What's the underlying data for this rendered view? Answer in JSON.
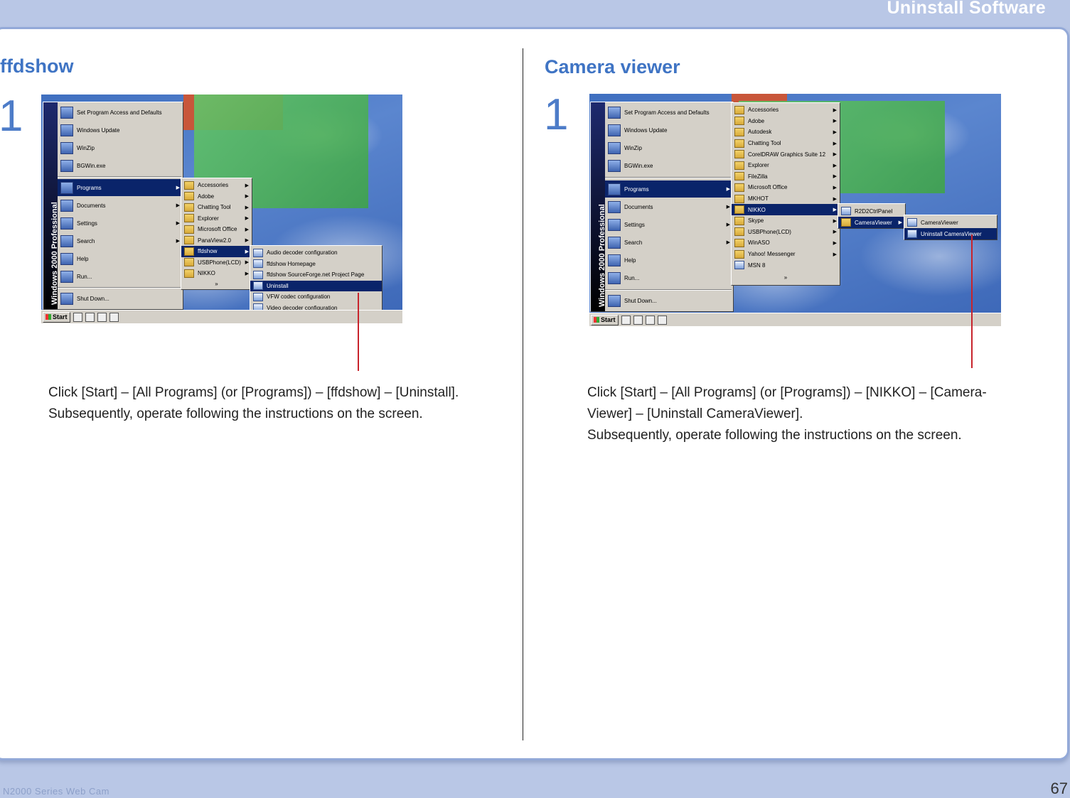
{
  "header": {
    "title": "Uninstall Software"
  },
  "left": {
    "title": "ffdshow",
    "step": "1",
    "instructions": [
      "Click [Start] – [All Programs] (or [Programs]) – [ffdshow] – [Uninstall].",
      "Subsequently, operate following the instructions on the screen."
    ],
    "screenshot": {
      "banner": "Windows 2000 Professional",
      "start_label": "Start",
      "start_top": [
        "Set Program Access and Defaults",
        "Windows Update",
        "WinZip",
        "BGWin.exe"
      ],
      "start_bottom": [
        "Programs",
        "Documents",
        "Settings",
        "Search",
        "Help",
        "Run...",
        "Shut Down..."
      ],
      "programs": [
        "Accessories",
        "Adobe",
        "Chatting Tool",
        "Explorer",
        "Microsoft Office",
        "PanaView2.0",
        "ffdshow",
        "USBPhone(LCD)",
        "NIKKO",
        "»"
      ],
      "ffdshow": [
        "Audio decoder configuration",
        "ffdshow Homepage",
        "ffdshow SourceForge.net Project Page",
        "Uninstall",
        "VFW codec configuration",
        "Video decoder configuration"
      ]
    }
  },
  "right": {
    "title": "Camera viewer",
    "step": "1",
    "instructions": [
      "Click [Start] – [All Programs] (or [Programs]) – [NIKKO] – [Camera-",
      "Viewer] – [Uninstall CameraViewer].",
      "Subsequently, operate following the instructions on the screen."
    ],
    "screenshot": {
      "banner": "Windows 2000 Professional",
      "start_label": "Start",
      "start_top": [
        "Set Program Access and Defaults",
        "Windows Update",
        "WinZip",
        "BGWin.exe"
      ],
      "start_bottom": [
        "Programs",
        "Documents",
        "Settings",
        "Search",
        "Help",
        "Run...",
        "Shut Down..."
      ],
      "programs": [
        "Accessories",
        "Adobe",
        "Autodesk",
        "Chatting Tool",
        "CorelDRAW Graphics Suite 12",
        "Explorer",
        "FileZilla",
        "Microsoft Office",
        "MKHOT",
        "NIKKO",
        "Skype",
        "USBPhone(LCD)",
        "WinASO",
        "Yahoo! Messenger",
        "MSN 8",
        "»"
      ],
      "nikko": [
        "R2D2CtrlPanel",
        "CameraViewer"
      ],
      "cameraviewer": [
        "CameraViewer",
        "Uninstall CameraViewer"
      ]
    }
  },
  "footer": {
    "page_number": "67",
    "left_text": "N2000 Series Web Cam"
  }
}
